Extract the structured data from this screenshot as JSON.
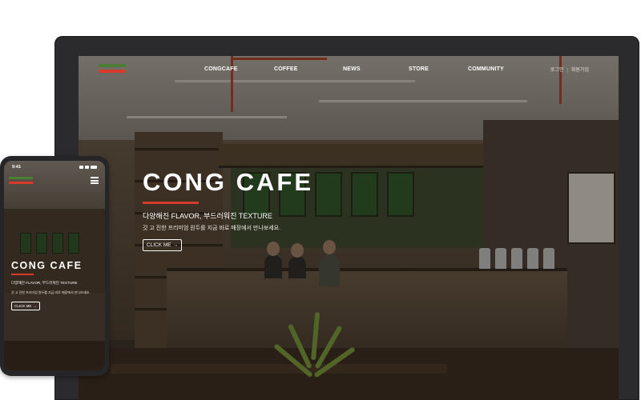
{
  "desktop": {
    "nav": {
      "links": [
        "CONGCAFE",
        "COFFEE",
        "NEWS",
        "STORE",
        "COMMUNITY"
      ],
      "login": "로그인",
      "separator": "|",
      "signup": "회원가입"
    },
    "hero": {
      "title": "CONG CAFE",
      "subtitle": "다양해진 FLAVOR, 부드러워진 TEXTURE",
      "description": "갓 고 진한 프리미엄 원두를 지금 바로 매장에서 만나보세요.",
      "button": "CLICK ME",
      "button_arrow": "→"
    }
  },
  "mobile": {
    "status_time": "9:41",
    "hero": {
      "title": "CONG CAFE",
      "subtitle": "다양해진 FLAVOR, 부드러워진 TEXTURE",
      "description": "갓 고 진한 프리미엄 원두를 지금 바로 매장에서 만나보세요.",
      "button": "CLICK ME",
      "button_arrow": "→"
    }
  },
  "colors": {
    "accent_red": "#d63a2a",
    "accent_green": "#4b7d32",
    "device_frame": "#2b2b2d"
  },
  "icons": {
    "logo": "congcafe-logo",
    "menu": "hamburger-menu-icon",
    "arrow": "arrow-right-icon"
  }
}
